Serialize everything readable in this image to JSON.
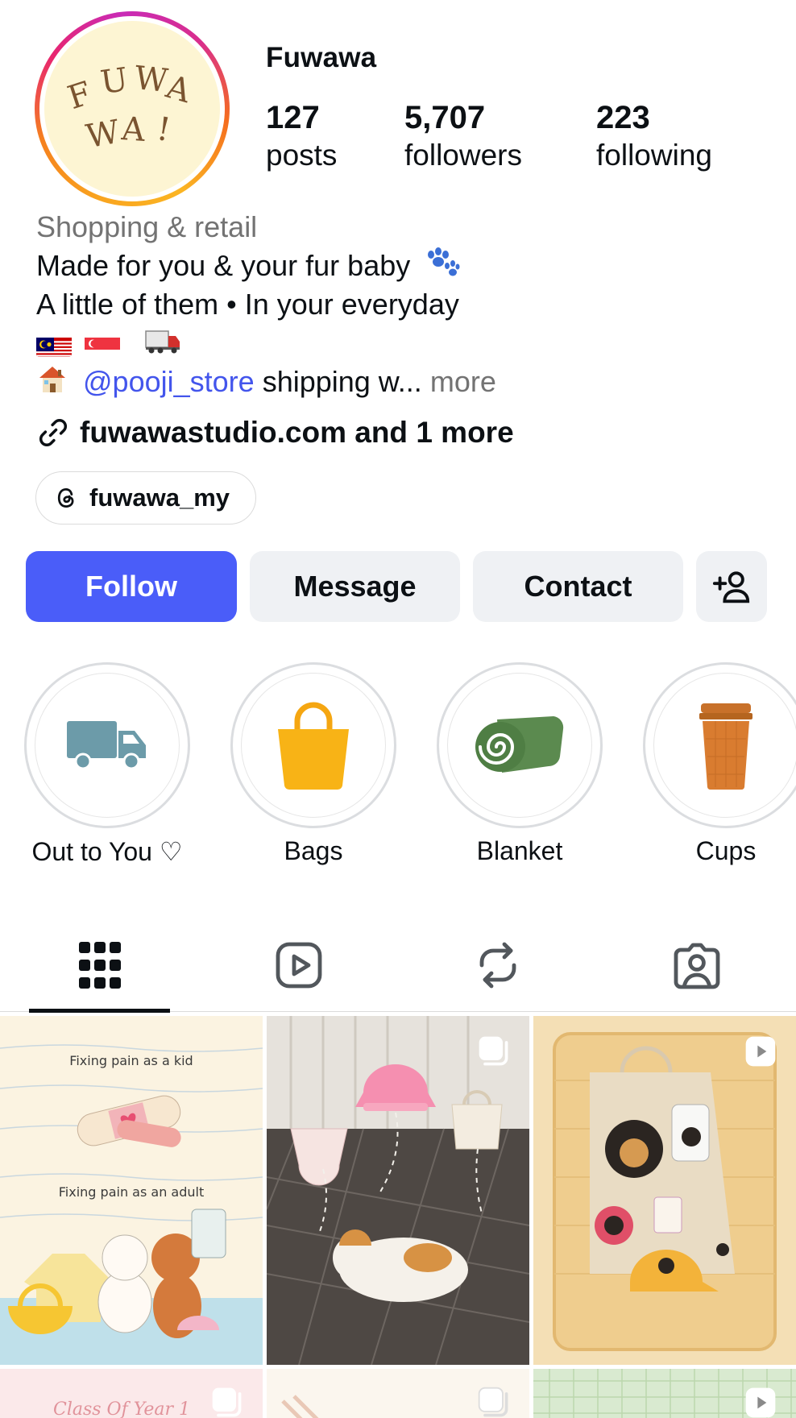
{
  "profile": {
    "username": "Fuwawa",
    "avatar_text": [
      "F",
      "U",
      "W",
      "A",
      "W",
      "A",
      "!"
    ],
    "stats": [
      {
        "value": "127",
        "label": "posts"
      },
      {
        "value": "5,707",
        "label": "followers"
      },
      {
        "value": "223",
        "label": "following"
      }
    ]
  },
  "bio": {
    "category": "Shopping & retail",
    "line1": "Made for you & your fur baby",
    "line2": "A little of them • In your everyday",
    "mention": "@pooji_store",
    "line4_rest": " shipping w...",
    "more": "more",
    "link": "fuwawastudio.com and 1 more",
    "threads_handle": "fuwawa_my"
  },
  "actions": {
    "follow": "Follow",
    "message": "Message",
    "contact": "Contact"
  },
  "highlights": [
    {
      "label": "Out to You ♡",
      "icon": "truck-icon"
    },
    {
      "label": "Bags",
      "icon": "bag-icon"
    },
    {
      "label": "Blanket",
      "icon": "blanket-icon"
    },
    {
      "label": "Cups",
      "icon": "cup-icon"
    }
  ],
  "tabs": [
    "grid-icon",
    "reels-icon",
    "reposts-icon",
    "tagged-icon"
  ],
  "posts": [
    {
      "caption_top": "Fixing pain as a kid",
      "caption_bottom": "Fixing pain as an adult"
    },
    {
      "badge": "carousel-icon"
    },
    {
      "badge": "reel-icon"
    },
    {
      "caption_top": "Class Of Year 1"
    }
  ],
  "colors": {
    "accent": "#4a5df9",
    "mention": "#4355ec",
    "muted": "#737373",
    "button_bg": "#eff1f4"
  }
}
